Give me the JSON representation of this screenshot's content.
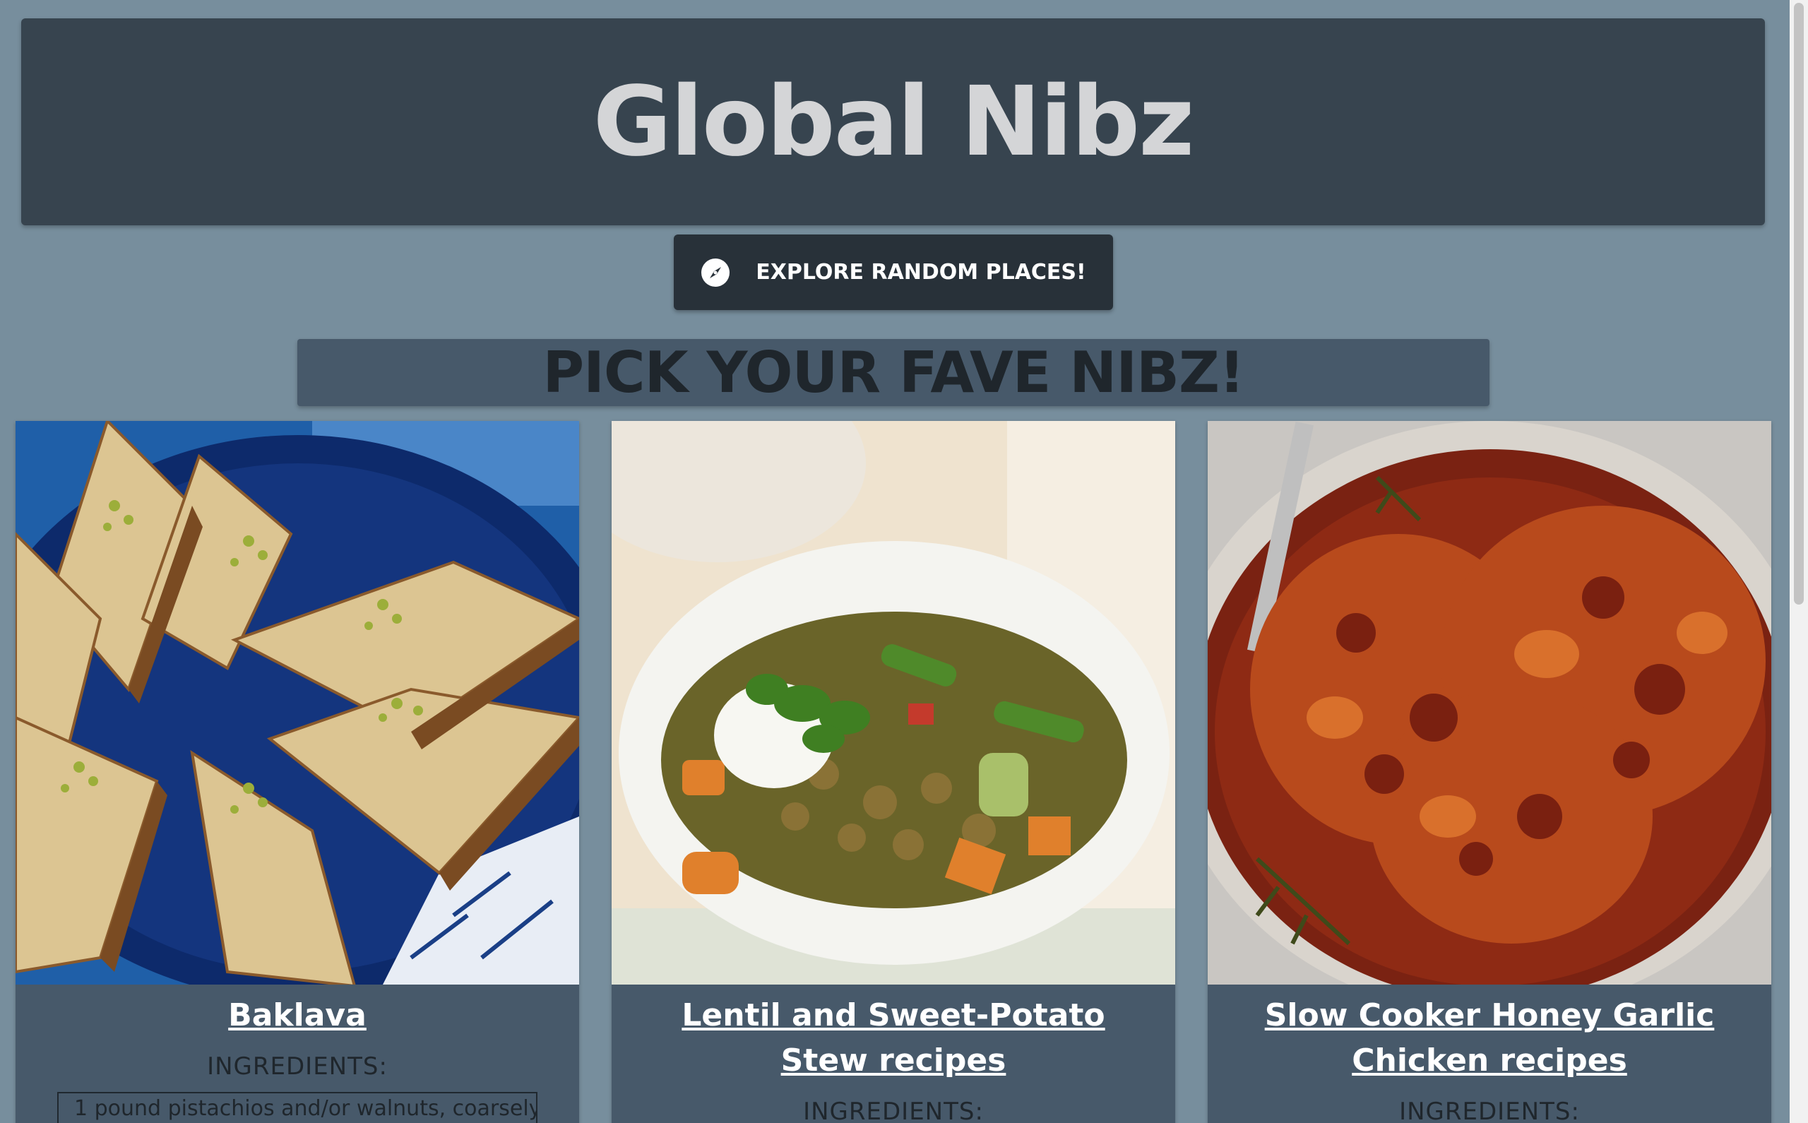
{
  "header": {
    "title": "Global Nibz"
  },
  "explore_button": {
    "label": "EXPLORE RANDOM PLACES!",
    "icon": "compass-icon"
  },
  "section": {
    "title": "PICK YOUR FAVE NIBZ!"
  },
  "cards": [
    {
      "title": "Baklava",
      "ingredients_label": "INGREDIENTS:",
      "first_ingredient": "1 pound pistachios and/or walnuts, coarsely",
      "image": "baklava-photo"
    },
    {
      "title": "Lentil and Sweet-Potato Stew recipes",
      "ingredients_label": "INGREDIENTS:",
      "image": "lentil-stew-photo"
    },
    {
      "title": "Slow Cooker Honey Garlic Chicken recipes",
      "ingredients_label": "INGREDIENTS:",
      "image": "honey-garlic-chicken-photo"
    }
  ],
  "colors": {
    "background": "#778e9d",
    "header": "#37444f",
    "button": "#283139",
    "card": "#47596a"
  }
}
